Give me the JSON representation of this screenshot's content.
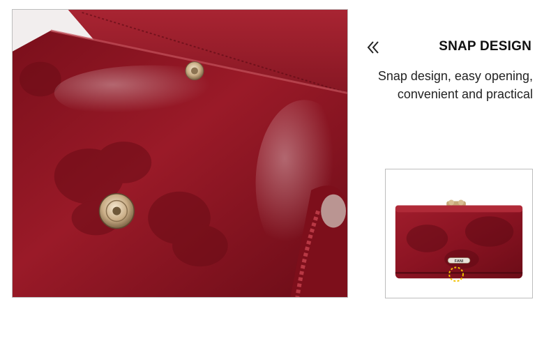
{
  "feature": {
    "title": "SNAP DESIGN",
    "description_lines": [
      "Snap design, easy opening,",
      "convenient and practical"
    ],
    "back_icon": "double-chevron-left-icon"
  },
  "thumbnail": {
    "brand_label": "FANI",
    "highlight_color": "#f2c200"
  },
  "colors": {
    "leather": "#8e1422",
    "leather_dark": "#5c0a14",
    "leather_light": "#b5323d",
    "snap_metal": "#c9ad86"
  }
}
